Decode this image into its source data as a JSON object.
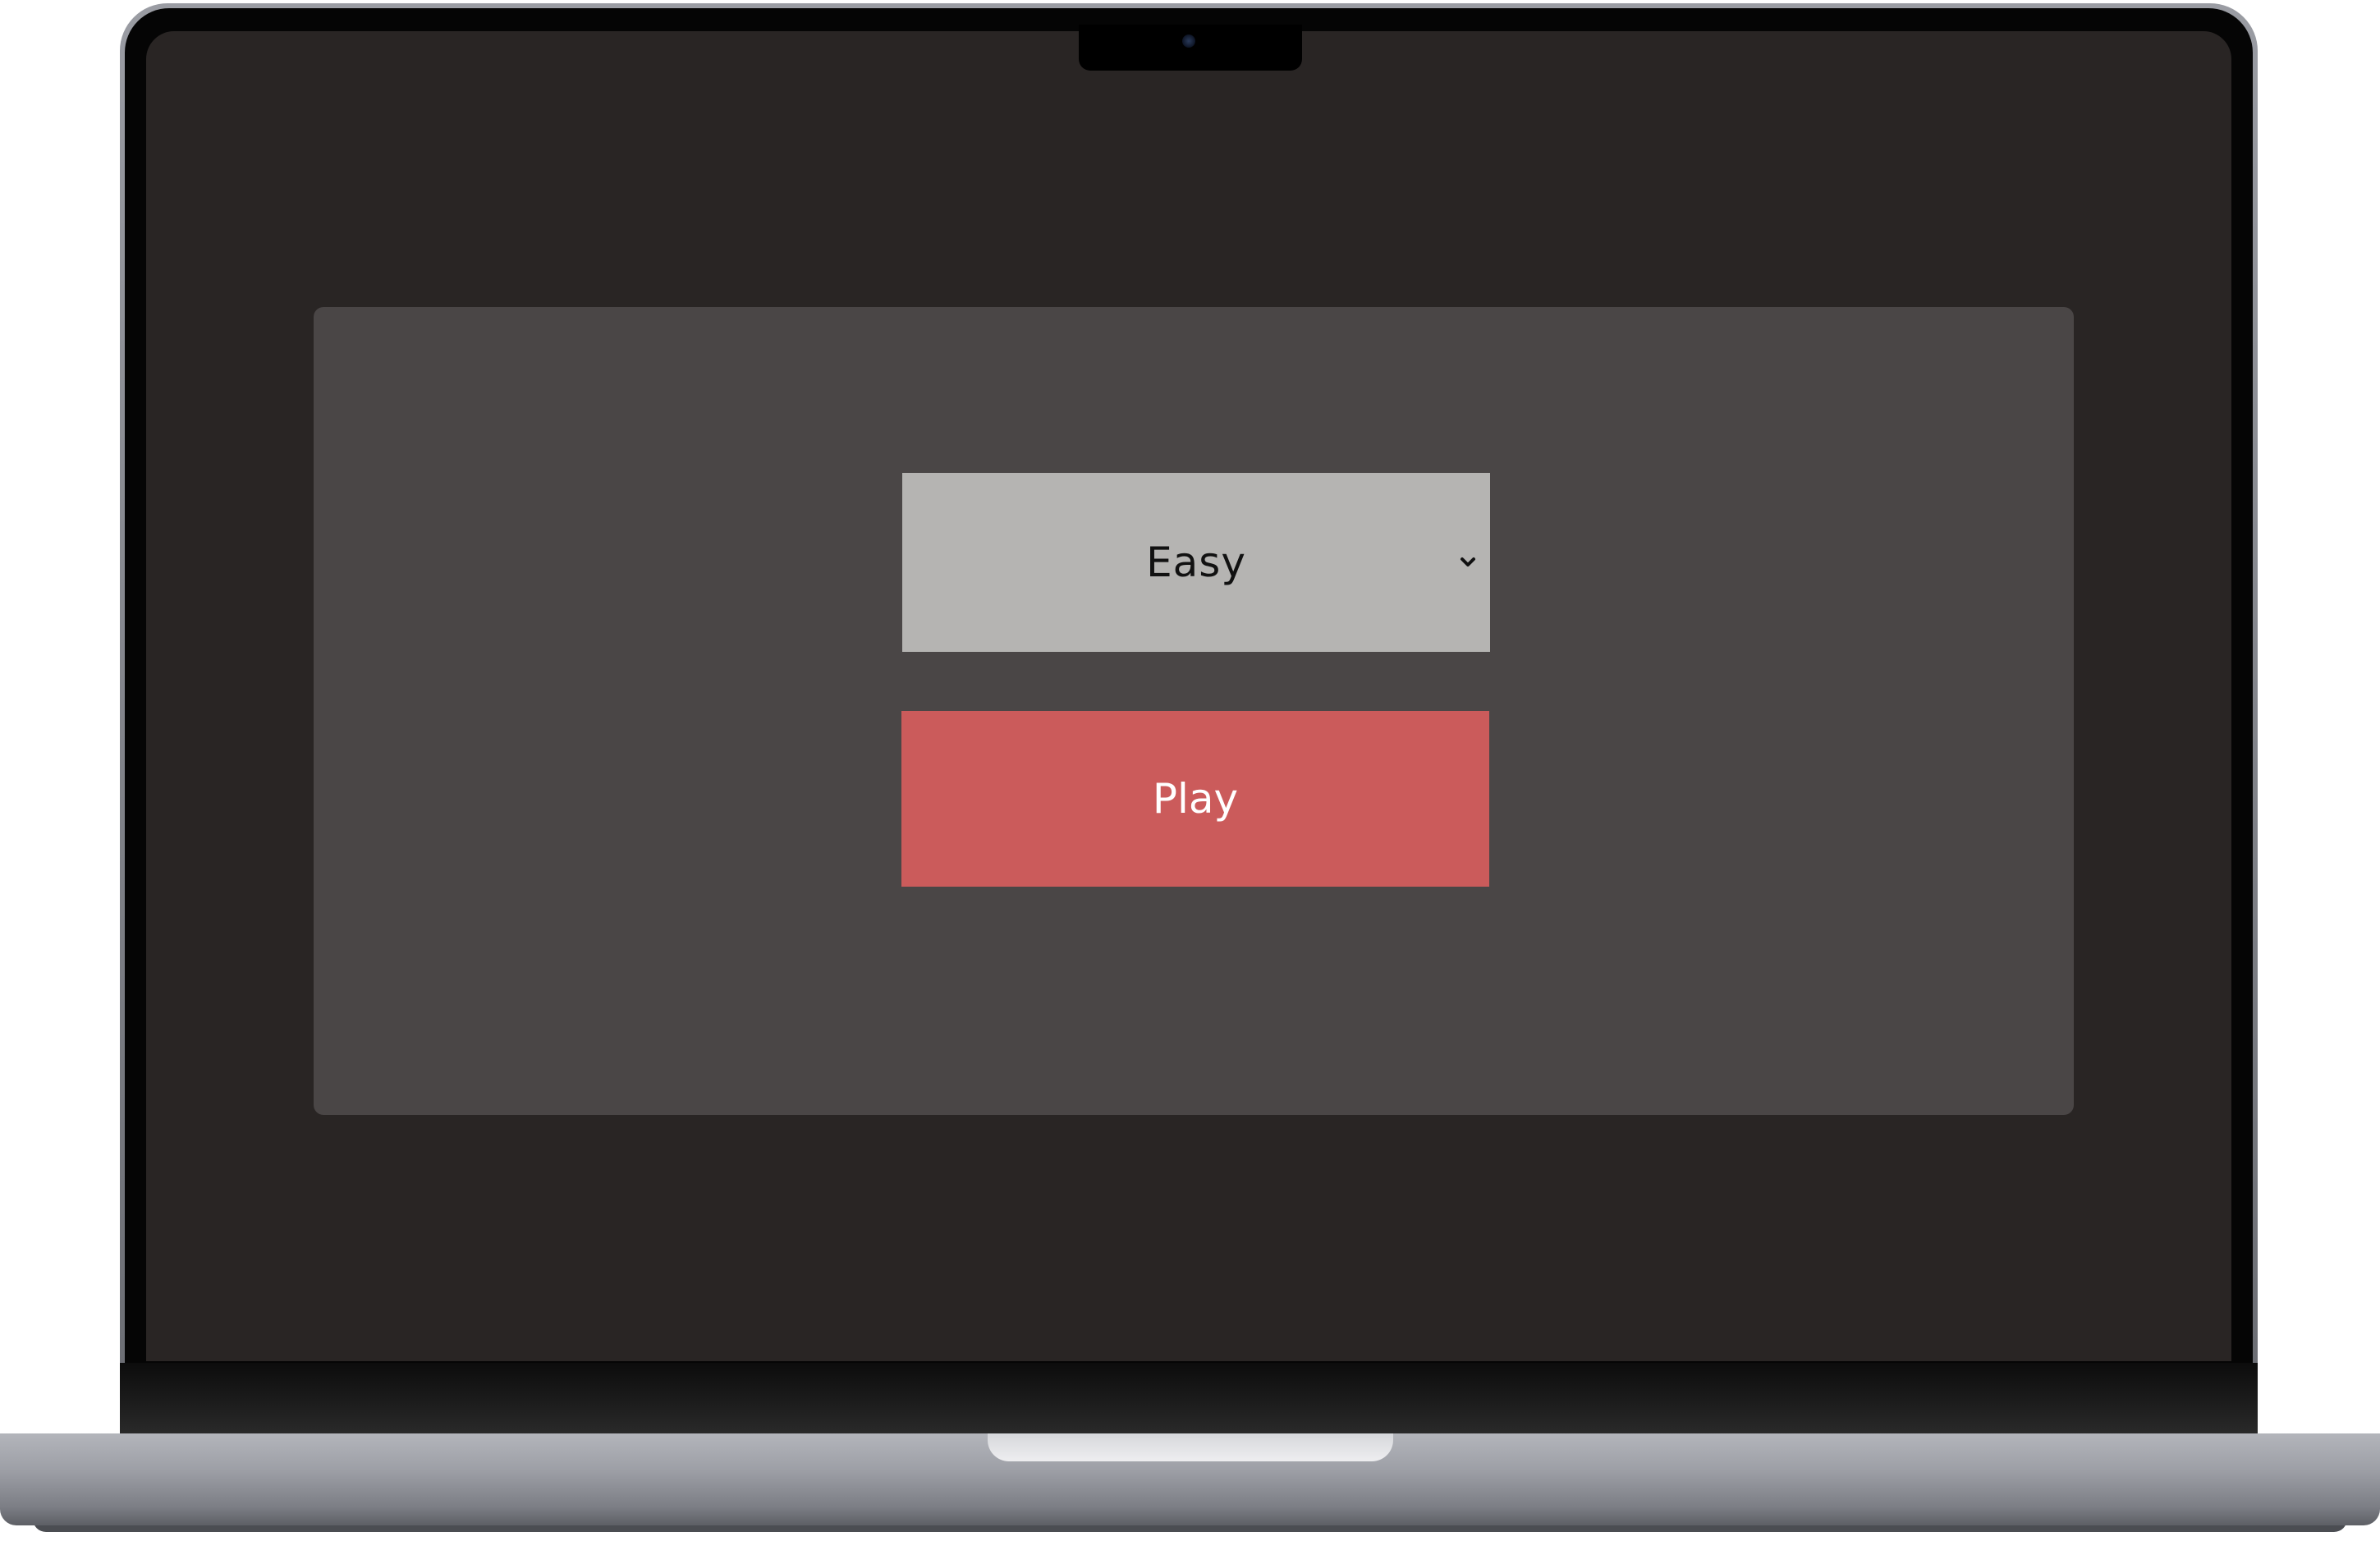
{
  "game_menu": {
    "difficulty": {
      "selected": "Easy",
      "icon": "chevron-down-icon"
    },
    "play_label": "Play"
  },
  "colors": {
    "screen_background": "#292524",
    "panel_background": "#4a4646",
    "select_background": "#b5b4b2",
    "play_button_background": "#cb5b5b",
    "play_button_text": "#ffffff"
  }
}
